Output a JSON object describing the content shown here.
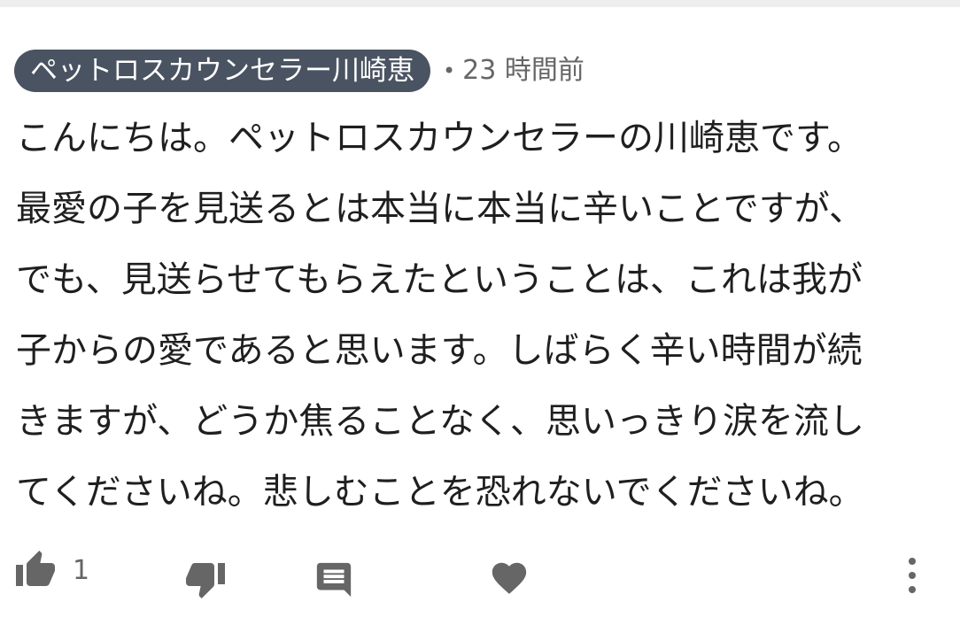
{
  "comment": {
    "author": "ペットロスカウンセラー川崎恵",
    "separator": "•",
    "time_ago": "23 時間前",
    "lines": [
      "こんにちは。ペットロスカウンセラーの川崎恵です。",
      "最愛の子を見送るとは本当に本当に辛いことですが、",
      "でも、見送らせてもらえたということは、これは我が",
      "子からの愛であると思います。しばらく辛い時間が続",
      "きますが、どうか焦ることなく、思いっきり涙を流し",
      "てくださいね。悲しむことを恐れないでくださいね。"
    ]
  },
  "actions": {
    "like_icon": "thumbs-up-icon",
    "like_count": "1",
    "dislike_icon": "thumbs-down-icon",
    "reply_icon": "comment-icon",
    "heart_icon": "heart-icon",
    "more_icon": "more-vertical-icon"
  },
  "colors": {
    "badge_background": "#4a5361",
    "icon_gray": "#666666",
    "text": "#1f1f1f"
  }
}
